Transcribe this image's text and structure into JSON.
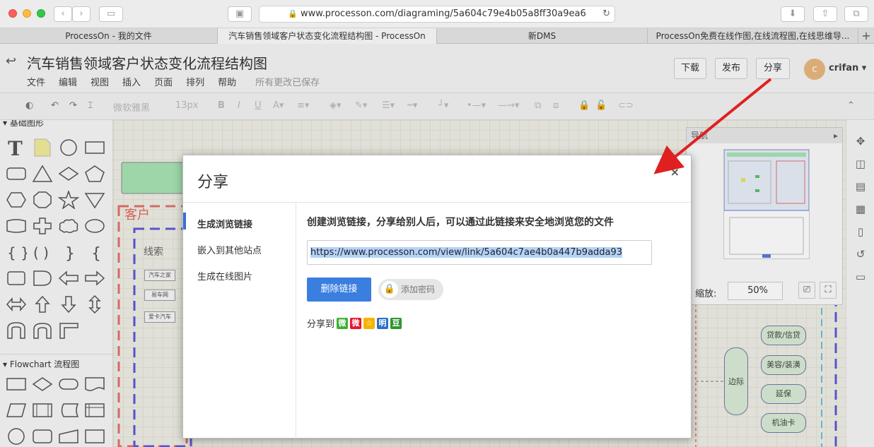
{
  "browser": {
    "url": "www.processon.com/diagraming/5a604c79e4b05a8ff30a9ea6",
    "tabs": [
      "ProcessOn - 我的文件",
      "汽车销售领域客户状态变化流程结构图 - ProcessOn",
      "新DMS",
      "ProcessOn免费在线作图,在线流程图,在线思维导..."
    ]
  },
  "header": {
    "title": "汽车销售领域客户状态变化流程结构图",
    "menu": [
      "文件",
      "编辑",
      "视图",
      "插入",
      "页面",
      "排列",
      "帮助"
    ],
    "saved": "所有更改已保存",
    "buttons": {
      "download": "下载",
      "publish": "发布",
      "share": "分享"
    },
    "avatar_letter": "c",
    "user": "crifan"
  },
  "toolbar": {
    "font": "微软雅黑",
    "size": "13px"
  },
  "left_panel": {
    "basic": "基础图形",
    "flowchart": "Flowchart 流程图"
  },
  "canvas": {
    "customer": "客户",
    "clue": "线索",
    "mini_boxes": [
      "汽车之家",
      "易车网",
      "爱卡汽车"
    ],
    "pills": [
      "贷款/信贷",
      "美容/装潢",
      "延保",
      "机油卡"
    ],
    "edge": "边际"
  },
  "navigator": {
    "title": "导航",
    "zoom_label": "缩放:",
    "zoom": "50%"
  },
  "dialog": {
    "title": "分享",
    "options": [
      "生成浏览链接",
      "嵌入到其他站点",
      "生成在线图片"
    ],
    "description": "创建浏览链接，分享给别人后，可以通过此链接来安全地浏览您的文件",
    "link": "https://www.processon.com/view/link/5a604c7ae4b0a447b9adda93",
    "delete": "删除链接",
    "add_password": "添加密码",
    "share_to": "分享到",
    "social": [
      "微",
      "微",
      "☆",
      "明",
      "豆"
    ]
  },
  "colors": {
    "accent": "#3a7ee0",
    "arrow": "#e02020"
  }
}
